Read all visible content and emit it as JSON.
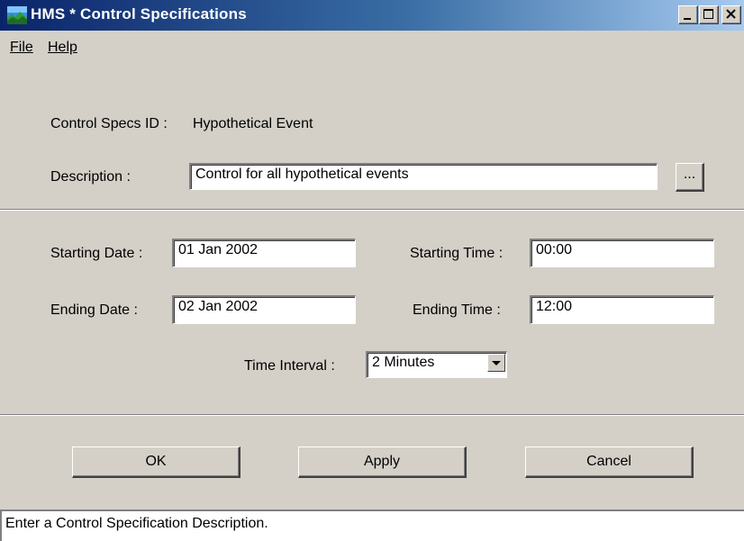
{
  "window": {
    "title": "HMS * Control Specifications",
    "icon": "hms-landscape-icon"
  },
  "menu": {
    "file_label": "File",
    "help_label": "Help"
  },
  "form": {
    "control_specs_id_label": "Control Specs ID :",
    "control_specs_id_value": "Hypothetical Event",
    "description_label": "Description :",
    "description_value": "Control for all hypothetical events",
    "description_browse_label": "...",
    "starting_date_label": "Starting Date :",
    "starting_date_value": "01 Jan 2002",
    "starting_time_label": "Starting Time :",
    "starting_time_value": "00:00",
    "ending_date_label": "Ending Date :",
    "ending_date_value": "02 Jan 2002",
    "ending_time_label": "Ending Time :",
    "ending_time_value": "12:00",
    "time_interval_label": "Time Interval :",
    "time_interval_value": "2 Minutes"
  },
  "buttons": {
    "ok_label": "OK",
    "apply_label": "Apply",
    "cancel_label": "Cancel"
  },
  "status": {
    "text": "Enter a Control Specification Description."
  },
  "colors": {
    "titlebar_start": "#0a246a",
    "titlebar_end": "#a6caf0",
    "dialog_face": "#d4d0c8"
  }
}
